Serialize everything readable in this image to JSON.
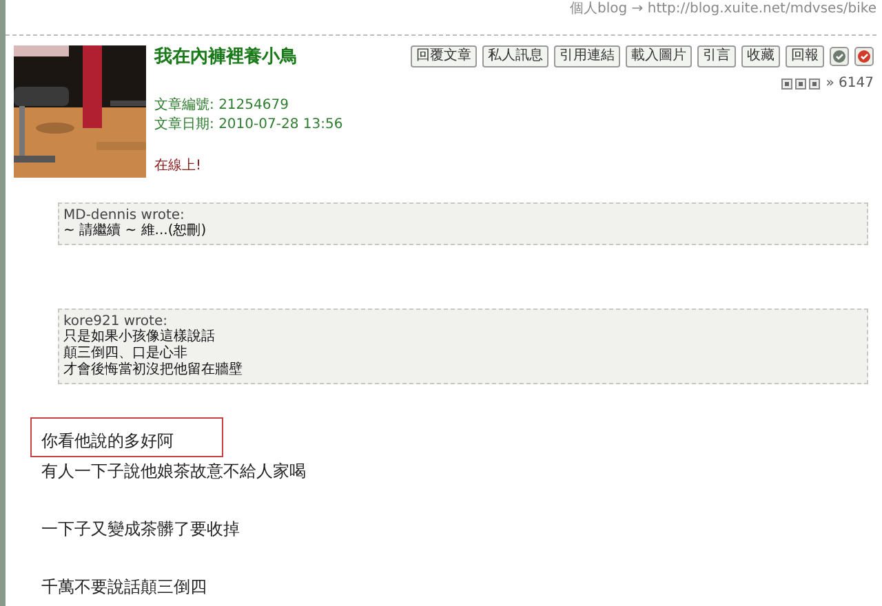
{
  "header_link": "個人blog → http://blog.xuite.net/mdvses/bike",
  "post": {
    "author": "我在內褲裡養小鳥",
    "buttons": [
      "回覆文章",
      "私人訊息",
      "引用連結",
      "載入圖片",
      "引言",
      "收藏",
      "回報"
    ],
    "icon_buttons": [
      {
        "kind": "gray"
      },
      {
        "kind": "red"
      }
    ],
    "count": "» 6147",
    "meta": [
      {
        "label": "文章編號:",
        "value": "21254679"
      },
      {
        "label": "文章日期:",
        "value": "2010-07-28 13:56"
      }
    ],
    "status": "在線上!",
    "quotes": [
      {
        "author": "MD-dennis wrote:",
        "lines": [
          "~ 請繼續 ~ 維...(恕刪)"
        ]
      },
      {
        "author": "kore921 wrote:",
        "lines": [
          "只是如果小孩像這樣說話",
          "顛三倒四、口是心非",
          "才會後悔當初沒把他留在牆壁"
        ]
      }
    ],
    "body": [
      {
        "lines": [
          {
            "text": "你看他說的多好阿",
            "highlighted": true
          },
          {
            "text": "有人一下子說他娘茶故意不給人家喝",
            "highlighted": false
          }
        ]
      },
      {
        "lines": [
          {
            "text": "一下子又變成茶髒了要收掉",
            "highlighted": false
          }
        ]
      },
      {
        "lines": [
          {
            "text": "千萬不要說話顛三倒四",
            "highlighted": false
          }
        ]
      }
    ]
  }
}
